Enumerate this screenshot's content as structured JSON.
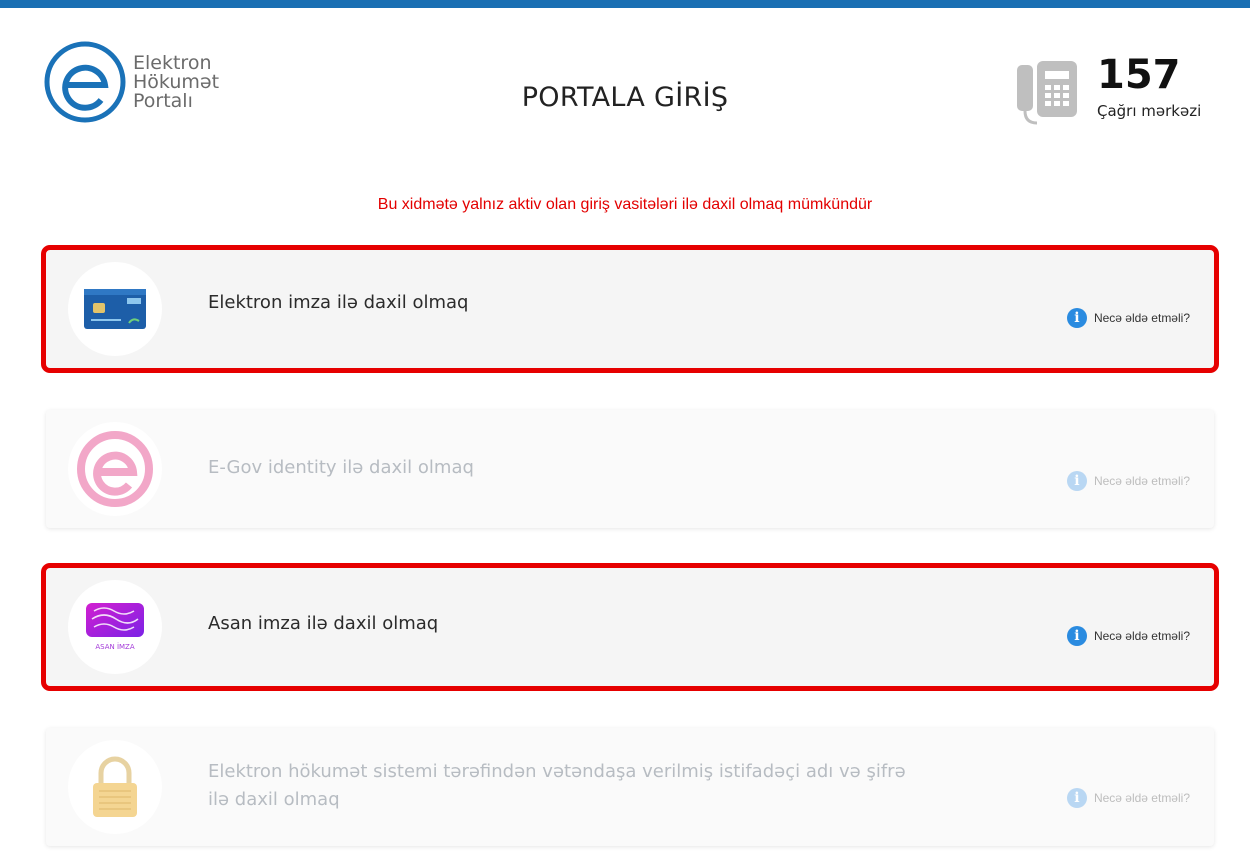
{
  "header": {
    "logo_lines": [
      "Elektron",
      "Hökumət",
      "Portalı"
    ],
    "title": "PORTALA GİRİŞ",
    "call_center": {
      "number": "157",
      "label": "Çağrı mərkəzi"
    }
  },
  "notice": "Bu xidmətə yalnız aktiv olan giriş vasitələri ilə daxil olmaq mümkündür",
  "login_options": [
    {
      "label": "Elektron imza ilə daxil olmaq",
      "help": "Necə əldə etməli?",
      "state": "active",
      "icon": "e-signature-card-icon"
    },
    {
      "label": "E-Gov identity ilə daxil olmaq",
      "help": "Necə əldə etməli?",
      "state": "disabled",
      "icon": "egov-identity-icon"
    },
    {
      "label": "Asan imza ilə daxil olmaq",
      "help": "Necə əldə etməli?",
      "state": "active",
      "icon": "asan-imza-icon",
      "icon_text": "ASAN İMZA"
    },
    {
      "label_lines": [
        "Elektron hökumət sistemi tərəfindən vətəndaşa verilmiş istifadəçi adı və şifrə",
        "ilə daxil olmaq"
      ],
      "help": "Necə əldə etməli?",
      "state": "disabled",
      "icon": "padlock-icon"
    }
  ],
  "colors": {
    "top_bar": "#1a6fb3",
    "notice": "#e30000",
    "highlight": "#e60000",
    "info": "#2a8be0"
  }
}
